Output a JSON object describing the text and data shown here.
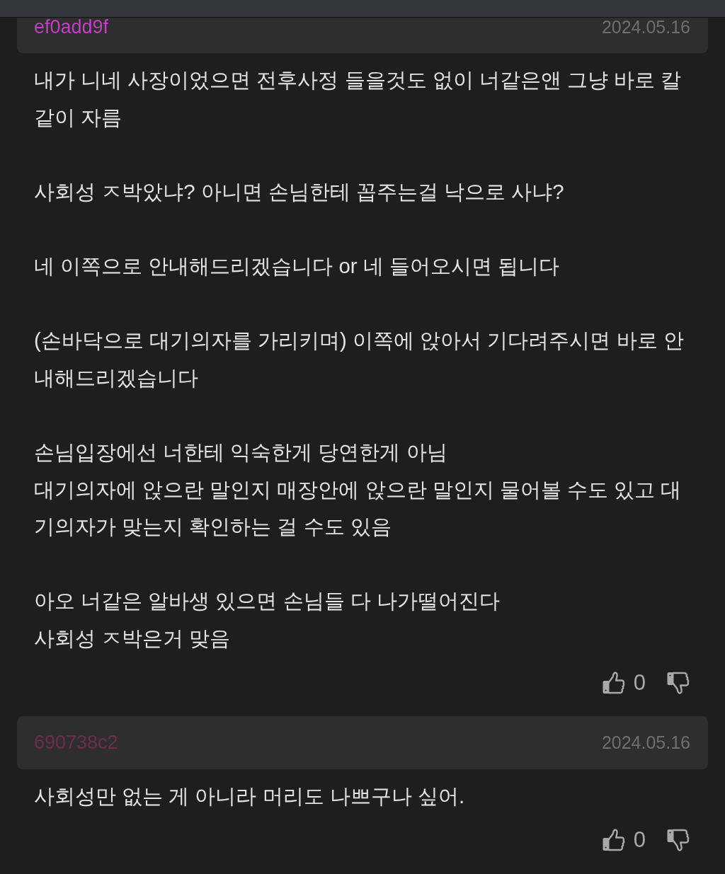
{
  "comments": [
    {
      "author": "ef0add9f",
      "color": "#c23fc6",
      "date": "2024.05.16",
      "paragraphs": [
        [
          "내가 니네 사장이었으면 전후사정 들을것도 없이 너같은앤 그냥 바로 칼같이 자름"
        ],
        [
          "사회성 ㅈ박았냐? 아니면 손님한테 꼽주는걸 낙으로 사냐?"
        ],
        [
          "네 이쪽으로 안내해드리겠습니다 or 네 들어오시면 됩니다"
        ],
        [
          "(손바닥으로 대기의자를 가리키며) 이쪽에 앉아서 기다려주시면 바로 안내해드리겠습니다"
        ],
        [
          "손님입장에선 너한테 익숙한게 당연한게 아님",
          "대기의자에 앉으란 말인지 매장안에 앉으란 말인지 물어볼 수도 있고 대기의자가 맞는지 확인하는 걸 수도 있음"
        ],
        [
          "아오 너같은 알바생 있으면 손님들 다 나가떨어진다",
          "사회성 ㅈ박은거 맞음"
        ]
      ],
      "likes": "0"
    },
    {
      "author": "690738c2",
      "color": "#6e2d4d",
      "date": "2024.05.16",
      "paragraphs": [
        [
          "사회성만 없는 게 아니라 머리도 나쁘구나 싶어."
        ]
      ],
      "likes": "0"
    }
  ]
}
